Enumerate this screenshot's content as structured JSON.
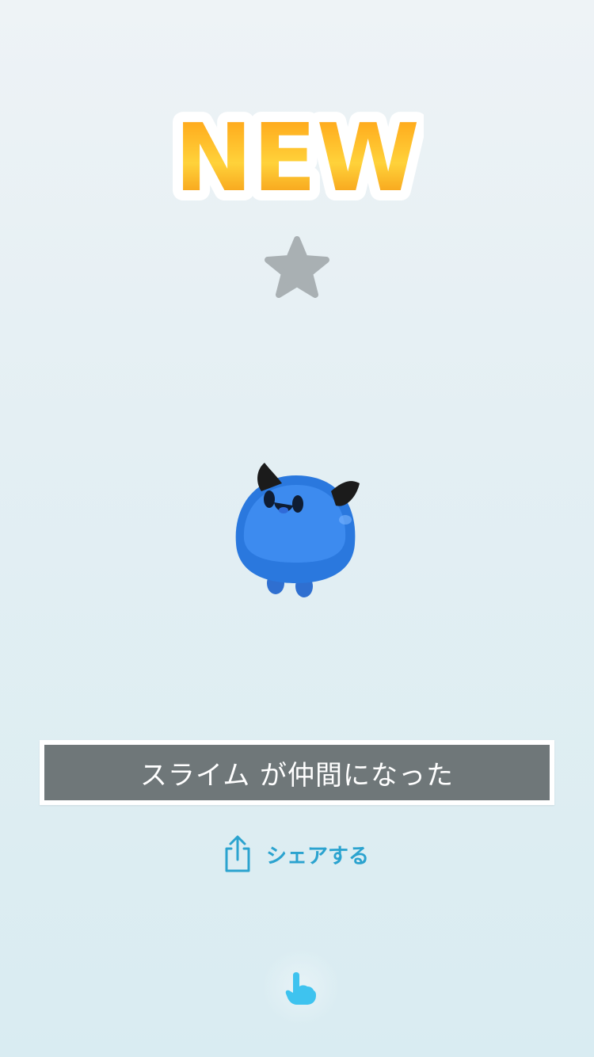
{
  "badge": {
    "text": "NEW"
  },
  "rank": {
    "icon": "star-icon",
    "color": "#a9b0b3"
  },
  "monster": {
    "icon": "slime-icon",
    "color": "#3b82e6"
  },
  "message": {
    "text": "スライム が仲間になった"
  },
  "share": {
    "label": "シェアする",
    "icon": "share-icon",
    "color": "#2ba3cf"
  },
  "tap": {
    "icon": "pointing-hand-icon",
    "color": "#3ec3ef"
  }
}
